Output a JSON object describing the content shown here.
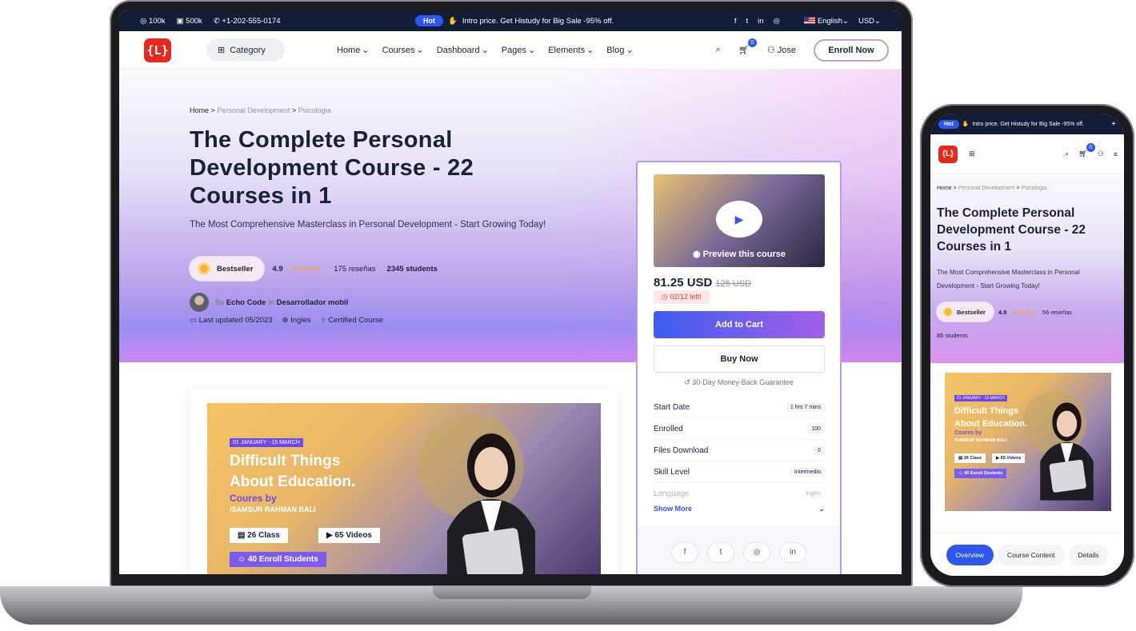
{
  "topbar": {
    "instagram_count": "100k",
    "facebook_count": "500k",
    "phone": "+1-202-555-0174",
    "hot_label": "Hot",
    "promo": "Intro price. Get Histudy for Big Sale -95% off.",
    "language": "English",
    "currency": "USD",
    "social_icons": [
      "facebook-icon",
      "twitter-icon",
      "linkedin-icon",
      "instagram-icon"
    ]
  },
  "nav": {
    "logo_text": "{L}",
    "category_label": "Category",
    "menu": [
      "Home",
      "Courses",
      "Dashboard",
      "Pages",
      "Elements",
      "Blog"
    ],
    "cart_count": "0",
    "user_name": "Jose",
    "enroll_label": "Enroll Now"
  },
  "breadcrumb": {
    "home": "Home",
    "sep1": ">",
    "cat": "Personal Development",
    "sep2": ">",
    "sub": "Psicologia"
  },
  "course": {
    "title": "The Complete Personal Development Course - 22 Courses in 1",
    "subtitle": "The Most Comprehensive Masterclass in Personal Development - Start Growing Today!",
    "bestseller": "Bestseller",
    "rating": "4.9",
    "stars": "★★★★★",
    "reviews": "175 reseñas",
    "students": "2345 students",
    "by_label": "By",
    "author": "Echo Code",
    "in_label": "In",
    "category": "Desarrollador mobil",
    "last_updated": "Last updated 05/2023",
    "language": "Ingles",
    "certified": "Certified Course"
  },
  "banner": {
    "date": "01 JANUARY - 15 MARCH",
    "heading_line1": "Difficult Things",
    "heading_line2": "About Education.",
    "by": "Coures by",
    "instructor": "/SAMSUR RAHMAN BALI",
    "classes": "26 Class",
    "videos": "65 Videos",
    "enroll": "40 Enroll Students"
  },
  "sidebar": {
    "preview": "Preview this course",
    "price": "81.25 USD",
    "old_price": "125 USD",
    "left": "02/12 left!",
    "add_to_cart": "Add to Cart",
    "buy_now": "Buy Now",
    "guarantee": "30-Day Money-Back Guarantee",
    "details": [
      {
        "label": "Start Date",
        "value": "1 hrs 7 mins"
      },
      {
        "label": "Enrolled",
        "value": "100"
      },
      {
        "label": "Files Download",
        "value": "0"
      },
      {
        "label": "Skill Level",
        "value": "Intermedio"
      },
      {
        "label": "Language",
        "value": "Ingles"
      }
    ],
    "show_more": "Show More"
  },
  "phone": {
    "hot_label": "Hot",
    "promo": "Intro price. Get Histudy for Big Sale -95% off.",
    "logo_text": "{L}",
    "cart_count": "0",
    "reviews": "56 reseñas",
    "students": "85 students",
    "tabs": [
      "Overview",
      "Course Content",
      "Details"
    ]
  },
  "colors": {
    "accent": "#2f57ef",
    "purple": "#b49df0",
    "topbar": "#121e37",
    "logo": "#e7281f"
  }
}
